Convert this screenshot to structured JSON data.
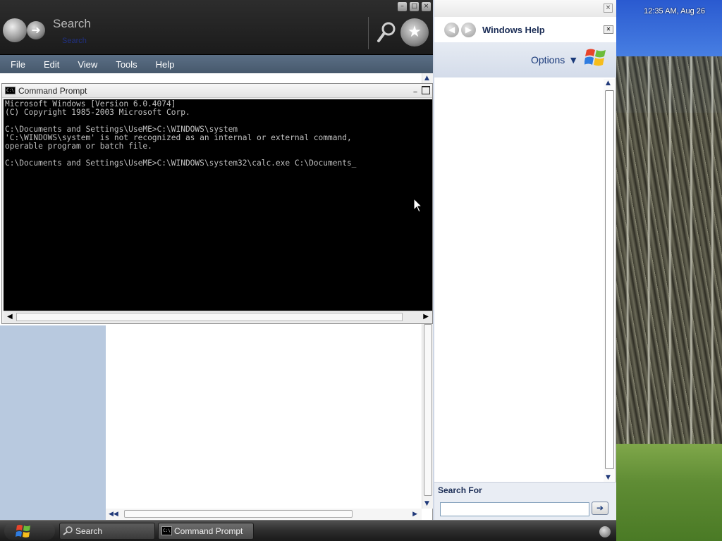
{
  "clock": "12:35 AM, Aug 26",
  "search_toolbar": {
    "label": "Search",
    "sublabel": "Search"
  },
  "menu": [
    "File",
    "Edit",
    "View",
    "Tools",
    "Help"
  ],
  "cmd": {
    "title": "Command Prompt",
    "lines": [
      "Microsoft Windows [Version 6.0.4074]",
      "(C) Copyright 1985-2003 Microsoft Corp.",
      "",
      "C:\\Documents and Settings\\UseME>C:\\WINDOWS\\system",
      "'C:\\WINDOWS\\system' is not recognized as an internal or external command,",
      "operable program or batch file.",
      "",
      "C:\\Documents and Settings\\UseME>C:\\WINDOWS\\system32\\calc.exe C:\\Documents_"
    ]
  },
  "help": {
    "title": "Windows Help",
    "options_label": "Options",
    "search_label": "Search For",
    "search_value": ""
  },
  "taskbar": {
    "items": [
      "Search",
      "Command Prompt"
    ]
  }
}
